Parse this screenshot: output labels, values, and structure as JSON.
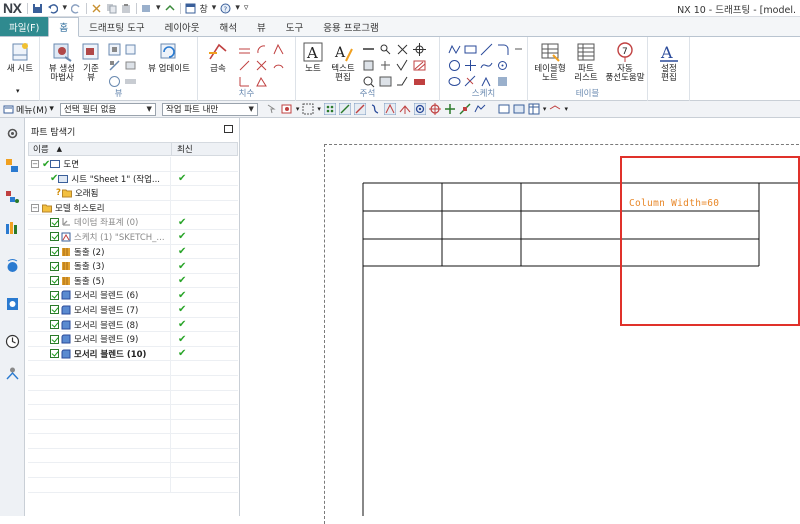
{
  "app": {
    "logo": "NX",
    "window_title": "NX 10 - 드래프팅 - [model."
  },
  "quick_access": {
    "snap_label": "창",
    "help_label": "?"
  },
  "tabs": [
    {
      "label": "파일(F)",
      "name": "tab-file"
    },
    {
      "label": "홈",
      "name": "tab-home"
    },
    {
      "label": "드래프팅 도구",
      "name": "tab-drafting-tools"
    },
    {
      "label": "레이아웃",
      "name": "tab-layout"
    },
    {
      "label": "해석",
      "name": "tab-analysis"
    },
    {
      "label": "뷰",
      "name": "tab-view"
    },
    {
      "label": "도구",
      "name": "tab-tools"
    },
    {
      "label": "응용 프로그램",
      "name": "tab-applications"
    }
  ],
  "ribbon": {
    "new_sheet": "새 시트",
    "view_create_wizard_1": "뷰 생성",
    "view_create_wizard_2": "마법사",
    "base_view_1": "기준",
    "base_view_2": "뷰",
    "view_update": "뷰 업데이트",
    "view_group": "뷰",
    "rapid_dim": "급속",
    "dimension_group": "치수",
    "note": "노트",
    "text_edit_1": "텍스트",
    "text_edit_2": "편집",
    "annotation_group": "주석",
    "sketch_group": "스케치",
    "tabular_note_1": "테이블형",
    "tabular_note_2": "노트",
    "parts_list_1": "파트",
    "parts_list_2": "리스트",
    "auto_balloon_1": "자동",
    "auto_balloon_2": "풍선도움말",
    "table_group": "테이블",
    "settings_edit_1": "설정",
    "settings_edit_2": "편집"
  },
  "toolbar": {
    "menu_label": "메뉴(M)",
    "selection_filter": "선택 필터 없음",
    "scope": "작업 파트 내만"
  },
  "navigator": {
    "title": "파트 탐색기",
    "col_name": "이름",
    "col_latest": "최신",
    "rows": [
      {
        "label": "도면",
        "latest": ""
      },
      {
        "label": "시트 \"Sheet 1\" (작업...",
        "latest": "✔"
      },
      {
        "label": "오래됨",
        "latest": ""
      },
      {
        "label": "모델 히스토리",
        "latest": ""
      },
      {
        "label": "데이텀 좌표계 (0)",
        "latest": "✔"
      },
      {
        "label": "스케치 (1) \"SKETCH_...",
        "latest": "✔"
      },
      {
        "label": "돌출 (2)",
        "latest": "✔"
      },
      {
        "label": "돌출 (3)",
        "latest": "✔"
      },
      {
        "label": "돌출 (5)",
        "latest": "✔"
      },
      {
        "label": "모서리 블렌드 (6)",
        "latest": "✔"
      },
      {
        "label": "모서리 블렌드 (7)",
        "latest": "✔"
      },
      {
        "label": "모서리 블렌드 (8)",
        "latest": "✔"
      },
      {
        "label": "모서리 블렌드 (9)",
        "latest": "✔"
      },
      {
        "label": "모서리 블렌드 (10)",
        "latest": "✔"
      }
    ]
  },
  "canvas": {
    "annotation": "Column Width=60"
  },
  "colors": {
    "file_tab": "#2f8a8f",
    "selection_box": "#e0312a",
    "annotation": "#e8882a",
    "check": "#2aa52a"
  }
}
